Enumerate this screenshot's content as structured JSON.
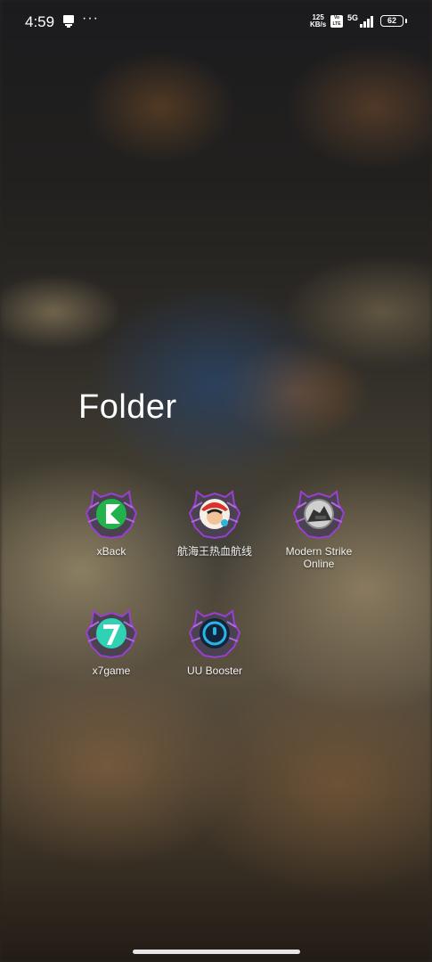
{
  "status_bar": {
    "time": "4:59",
    "net_speed_value": "125",
    "net_speed_unit": "KB/s",
    "volte_label": "Vo LTE",
    "network": "5G",
    "battery": "62",
    "icons": [
      "notification-icon",
      "more-dots-icon",
      "signal-icon",
      "battery-icon"
    ]
  },
  "folder": {
    "title": "Folder",
    "apps": [
      {
        "label": "xBack",
        "icon": "xback-icon",
        "icon_color": "#22b24c"
      },
      {
        "label": "航海王热血航线",
        "icon": "one-piece-icon",
        "icon_color": "#d8322c"
      },
      {
        "label": "Modern Strike Online",
        "icon": "modern-strike-icon",
        "icon_color": "#555555"
      },
      {
        "label": "x7game",
        "icon": "x7game-icon",
        "icon_color": "#2fd3b3"
      },
      {
        "label": "UU Booster",
        "icon": "uu-booster-icon",
        "icon_color": "#27b7e6"
      }
    ]
  },
  "theme": {
    "frame_color": "#5b5161",
    "accent_purple": "#9a3fd1"
  }
}
